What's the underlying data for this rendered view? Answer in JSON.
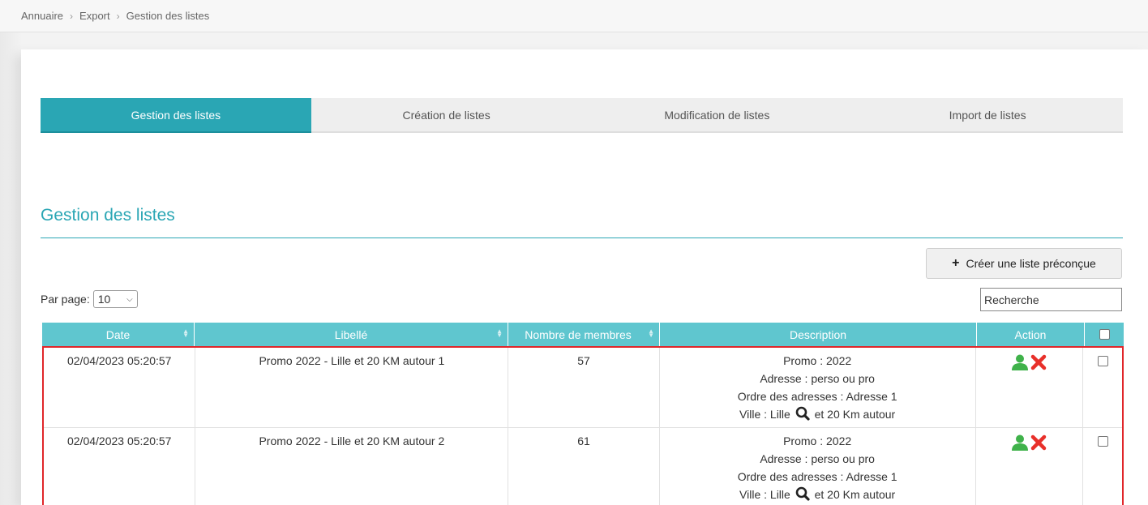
{
  "breadcrumb": [
    "Annuaire",
    "Export",
    "Gestion des listes"
  ],
  "tabs": [
    {
      "label": "Gestion des listes",
      "active": true
    },
    {
      "label": "Création de listes",
      "active": false
    },
    {
      "label": "Modification de listes",
      "active": false
    },
    {
      "label": "Import de listes",
      "active": false
    }
  ],
  "section_title": "Gestion des listes",
  "create_button": "Créer une liste préconçue",
  "per_page": {
    "label": "Par page:",
    "value": "10"
  },
  "search": {
    "placeholder": "Recherche"
  },
  "table": {
    "headers": {
      "date": "Date",
      "libelle": "Libellé",
      "nombre": "Nombre de membres",
      "description": "Description",
      "action": "Action"
    },
    "rows": [
      {
        "date": "02/04/2023 05:20:57",
        "libelle": "Promo 2022 - Lille et 20 KM autour 1",
        "nombre": "57",
        "desc_promo": "Promo : 2022",
        "desc_adresse": "Adresse : perso ou pro",
        "desc_ordre": "Ordre des adresses : Adresse 1",
        "desc_ville_prefix": "Ville : Lille",
        "desc_ville_suffix": "et 20 Km autour"
      },
      {
        "date": "02/04/2023 05:20:57",
        "libelle": "Promo 2022 - Lille et 20 KM autour 2",
        "nombre": "61",
        "desc_promo": "Promo : 2022",
        "desc_adresse": "Adresse : perso ou pro",
        "desc_ordre": "Ordre des adresses : Adresse 1",
        "desc_ville_prefix": "Ville : Lille",
        "desc_ville_suffix": "et 20 Km autour"
      }
    ]
  },
  "colors": {
    "accent": "#2aa6b4",
    "header_bg": "#5fc6cf",
    "highlight_border": "#e0262a",
    "user_icon": "#3fb24a",
    "delete_icon": "#e8302a"
  },
  "icons": {
    "user": "user-icon",
    "delete": "delete-icon",
    "search": "search-icon",
    "sort": "sort-icon",
    "plus": "plus-icon",
    "chevron": "chevron-down-icon"
  }
}
